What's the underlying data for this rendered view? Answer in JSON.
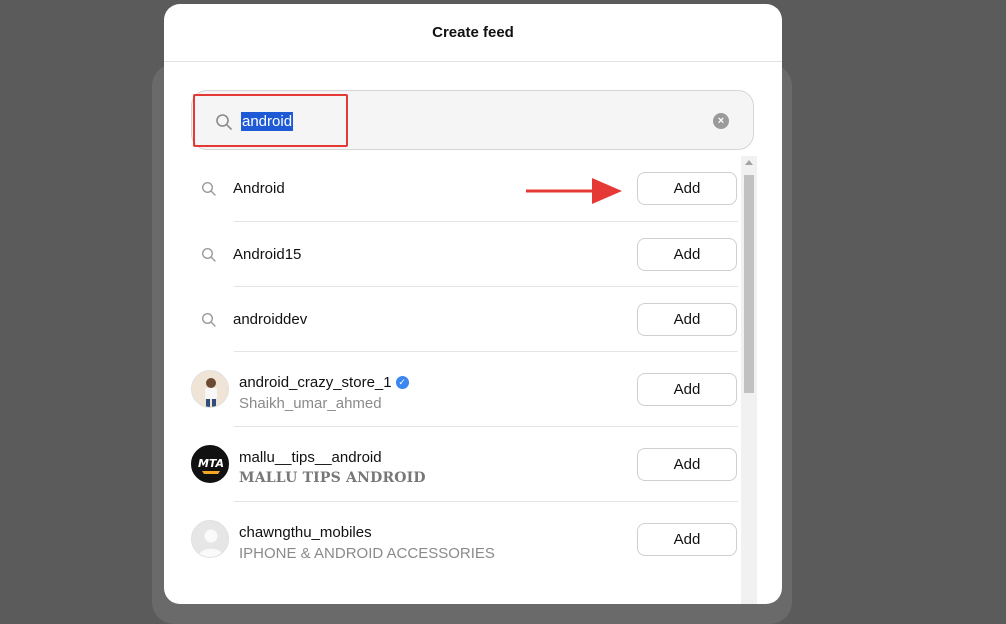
{
  "modal": {
    "title": "Create feed"
  },
  "search": {
    "value": "android",
    "clear_label": "×"
  },
  "keywords": [
    {
      "label": "Android",
      "add_label": "Add"
    },
    {
      "label": "Android15",
      "add_label": "Add"
    },
    {
      "label": "androiddev",
      "add_label": "Add"
    }
  ],
  "accounts": [
    {
      "username": "android_crazy_store_1",
      "subtitle": "Shaikh_umar_ahmed",
      "verified": true,
      "add_label": "Add"
    },
    {
      "username": "mallu__tips__android",
      "subtitle": "MALLU TIPS ANDROID",
      "logo_text": "MTA",
      "add_label": "Add"
    },
    {
      "username": "chawngthu_mobiles",
      "subtitle": "IPHONE & ANDROID ACCESSORIES",
      "add_label": "Add"
    }
  ],
  "verified_mark": "✓",
  "colors": {
    "highlight_border": "#e53935",
    "arrow": "#e53935",
    "verified": "#3b86f0",
    "selection": "#1f5ad6"
  }
}
